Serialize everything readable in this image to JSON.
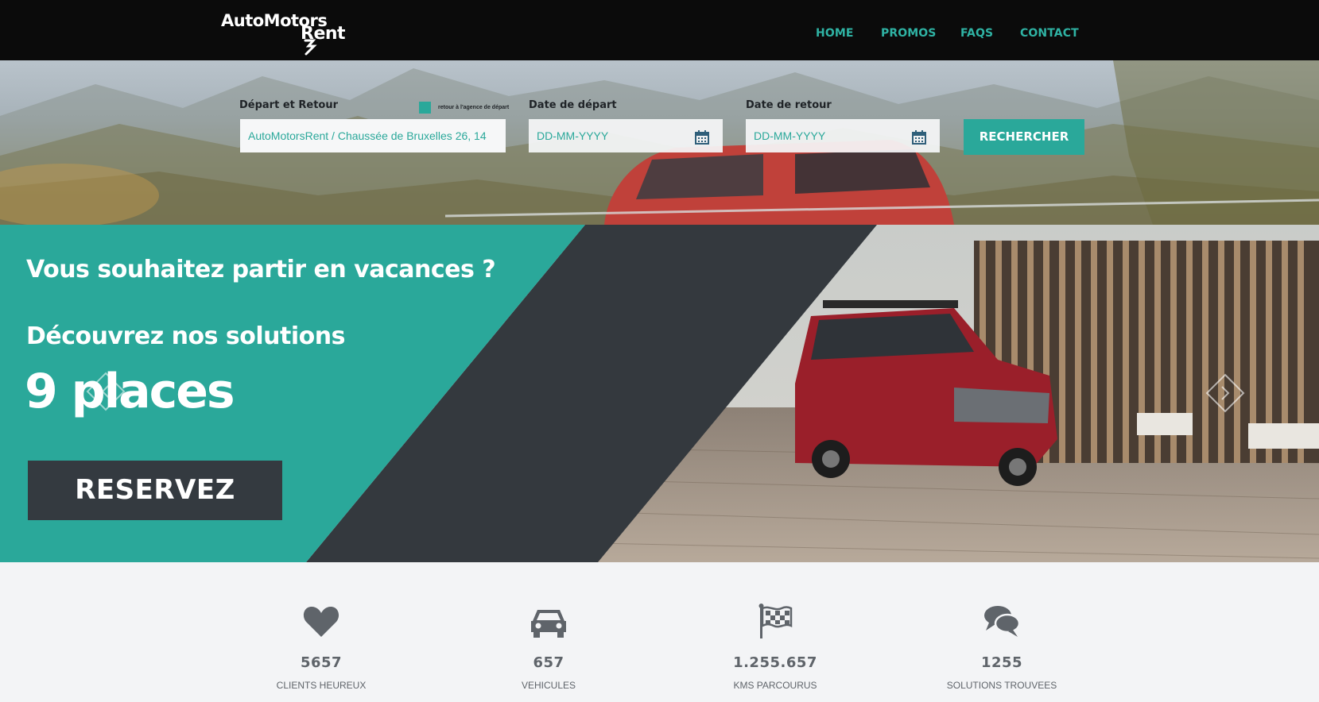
{
  "brand": {
    "line1": "AutoMotors",
    "line2": "Rent"
  },
  "nav": [
    {
      "label": "HOME"
    },
    {
      "label": "PROMOS"
    },
    {
      "label": "FAQS"
    },
    {
      "label": "CONTACT"
    }
  ],
  "search": {
    "location_label": "Départ et Retour",
    "return_checkbox_label": "retour à l'agence de départ",
    "location_value": "AutoMotorsRent / Chaussée de Bruxelles 26, 14",
    "departure_label": "Date de départ",
    "departure_placeholder": "DD-MM-YYYY",
    "return_label": "Date de retour",
    "return_placeholder": "DD-MM-YYYY",
    "button_label": "RECHERCHER"
  },
  "hero": {
    "title": "Vous souhaitez partir en vacances ?",
    "subtitle": "Découvrez nos solutions",
    "highlight": "9 places",
    "cta_label": "RESERVEZ"
  },
  "stats": [
    {
      "icon": "heart-icon",
      "value": "5657",
      "label": "CLIENTS HEUREUX"
    },
    {
      "icon": "car-icon",
      "value": "657",
      "label": "VEHICULES"
    },
    {
      "icon": "flag-icon",
      "value": "1.255.657",
      "label": "KMS PARCOURUS"
    },
    {
      "icon": "chat-icon",
      "value": "1255",
      "label": "SOLUTIONS TROUVEES"
    }
  ],
  "colors": {
    "accent": "#2aa89a",
    "dark": "#343a40",
    "nav_bg": "#0b0b0b",
    "text_muted": "#5f646a"
  }
}
